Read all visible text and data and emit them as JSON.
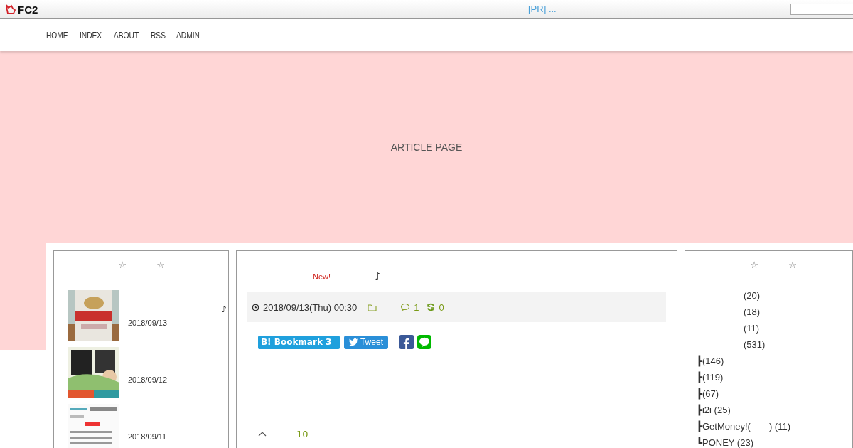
{
  "topbar": {
    "logo": "FC2",
    "pr_link": "[PR] ..."
  },
  "nav": [
    "HOME",
    "INDEX",
    "ABOUT",
    "RSS",
    "ADMIN"
  ],
  "header": {
    "title": "ARTICLE PAGE"
  },
  "left_sidebar": {
    "title_marks": [
      "☆",
      "☆"
    ],
    "entries": [
      {
        "date": "2018/09/13",
        "note": "♪"
      },
      {
        "date": "2018/09/12"
      },
      {
        "date": "2018/09/11"
      }
    ]
  },
  "article": {
    "new_badge": "New!",
    "title_mark": "♪",
    "datetime": "2018/09/13(Thu) 00:30",
    "comments": "1",
    "trackbacks": "0",
    "share": {
      "bookmark": "B! Bookmark 3",
      "tweet": "Tweet"
    },
    "footer_count": "10"
  },
  "right_sidebar": {
    "title_marks": [
      "☆",
      "☆"
    ],
    "categories": [
      {
        "label": "(20)"
      },
      {
        "label": "(18)"
      },
      {
        "label": "(11)"
      },
      {
        "label": "(531)"
      },
      {
        "branch": "┣",
        "label": "(146)"
      },
      {
        "branch": "┣",
        "label": "(119)"
      },
      {
        "branch": "┣",
        "label": "(67)"
      },
      {
        "branch": "┣",
        "label": "i2i (25)"
      },
      {
        "branch": "┣",
        "label": "GetMoney!(　　) (11)"
      },
      {
        "branch": "┗",
        "label": "PONEY (23)"
      }
    ]
  }
}
